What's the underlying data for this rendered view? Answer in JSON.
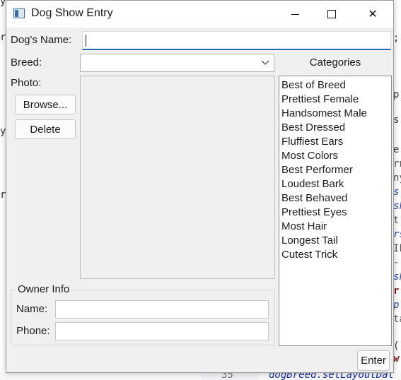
{
  "window": {
    "title": "Dog Show Entry"
  },
  "titlebar": {
    "minimize": "—",
    "maximize": "□",
    "close": "✕"
  },
  "form": {
    "dog_name_label": "Dog's Name:",
    "dog_name_value": "",
    "breed_label": "Breed:",
    "breed_value": "",
    "photo_label": "Photo:",
    "browse_label": "Browse...",
    "delete_label": "Delete",
    "enter_label": "Enter"
  },
  "categories": {
    "header": "Categories",
    "items": [
      "Best of Breed",
      "Prettiest Female",
      "Handsomest Male",
      "Best Dressed",
      "Fluffiest Ears",
      "Most Colors",
      "Best Performer",
      "Loudest Bark",
      "Best Behaved",
      "Prettiest Eyes",
      "Most Hair",
      "Longest Tail",
      "Cutest Trick"
    ]
  },
  "owner": {
    "group_title": "Owner Info",
    "name_label": "Name:",
    "name_value": "",
    "phone_label": "Phone:",
    "phone_value": ""
  },
  "background": {
    "left_fragments": [
      "y",
      "ri",
      "y",
      "ri"
    ],
    "right_fragments": [
      ";",
      "p;",
      "s;",
      "e;",
      "rn",
      "ny",
      "s",
      "sh",
      "t",
      "rs",
      "IL",
      "-",
      "sh",
      "r",
      "p",
      "ta",
      "(",
      "w"
    ],
    "line_number": "35",
    "code_line": "dogBreed.setLayoutDat"
  },
  "colors": {
    "window_bg": "#f0f0f0",
    "focus_accent": "#1f6fb2",
    "field_bg": "#ffffff"
  }
}
